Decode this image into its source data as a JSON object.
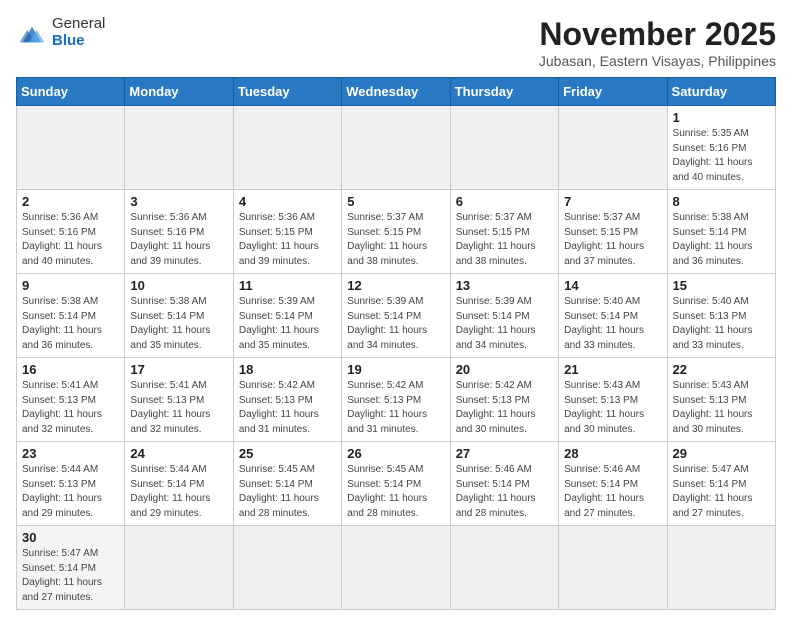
{
  "logo": {
    "line1": "General",
    "line2": "Blue"
  },
  "title": "November 2025",
  "subtitle": "Jubasan, Eastern Visayas, Philippines",
  "weekdays": [
    "Sunday",
    "Monday",
    "Tuesday",
    "Wednesday",
    "Thursday",
    "Friday",
    "Saturday"
  ],
  "weeks": [
    [
      {
        "day": "",
        "empty": true
      },
      {
        "day": "",
        "empty": true
      },
      {
        "day": "",
        "empty": true
      },
      {
        "day": "",
        "empty": true
      },
      {
        "day": "",
        "empty": true
      },
      {
        "day": "",
        "empty": true
      },
      {
        "day": "1",
        "sunrise": "5:35 AM",
        "sunset": "5:16 PM",
        "daylight": "11 hours and 40 minutes."
      }
    ],
    [
      {
        "day": "2",
        "sunrise": "5:36 AM",
        "sunset": "5:16 PM",
        "daylight": "11 hours and 40 minutes."
      },
      {
        "day": "3",
        "sunrise": "5:36 AM",
        "sunset": "5:16 PM",
        "daylight": "11 hours and 39 minutes."
      },
      {
        "day": "4",
        "sunrise": "5:36 AM",
        "sunset": "5:15 PM",
        "daylight": "11 hours and 39 minutes."
      },
      {
        "day": "5",
        "sunrise": "5:37 AM",
        "sunset": "5:15 PM",
        "daylight": "11 hours and 38 minutes."
      },
      {
        "day": "6",
        "sunrise": "5:37 AM",
        "sunset": "5:15 PM",
        "daylight": "11 hours and 38 minutes."
      },
      {
        "day": "7",
        "sunrise": "5:37 AM",
        "sunset": "5:15 PM",
        "daylight": "11 hours and 37 minutes."
      },
      {
        "day": "8",
        "sunrise": "5:38 AM",
        "sunset": "5:14 PM",
        "daylight": "11 hours and 36 minutes."
      }
    ],
    [
      {
        "day": "9",
        "sunrise": "5:38 AM",
        "sunset": "5:14 PM",
        "daylight": "11 hours and 36 minutes."
      },
      {
        "day": "10",
        "sunrise": "5:38 AM",
        "sunset": "5:14 PM",
        "daylight": "11 hours and 35 minutes."
      },
      {
        "day": "11",
        "sunrise": "5:39 AM",
        "sunset": "5:14 PM",
        "daylight": "11 hours and 35 minutes."
      },
      {
        "day": "12",
        "sunrise": "5:39 AM",
        "sunset": "5:14 PM",
        "daylight": "11 hours and 34 minutes."
      },
      {
        "day": "13",
        "sunrise": "5:39 AM",
        "sunset": "5:14 PM",
        "daylight": "11 hours and 34 minutes."
      },
      {
        "day": "14",
        "sunrise": "5:40 AM",
        "sunset": "5:14 PM",
        "daylight": "11 hours and 33 minutes."
      },
      {
        "day": "15",
        "sunrise": "5:40 AM",
        "sunset": "5:13 PM",
        "daylight": "11 hours and 33 minutes."
      }
    ],
    [
      {
        "day": "16",
        "sunrise": "5:41 AM",
        "sunset": "5:13 PM",
        "daylight": "11 hours and 32 minutes."
      },
      {
        "day": "17",
        "sunrise": "5:41 AM",
        "sunset": "5:13 PM",
        "daylight": "11 hours and 32 minutes."
      },
      {
        "day": "18",
        "sunrise": "5:42 AM",
        "sunset": "5:13 PM",
        "daylight": "11 hours and 31 minutes."
      },
      {
        "day": "19",
        "sunrise": "5:42 AM",
        "sunset": "5:13 PM",
        "daylight": "11 hours and 31 minutes."
      },
      {
        "day": "20",
        "sunrise": "5:42 AM",
        "sunset": "5:13 PM",
        "daylight": "11 hours and 30 minutes."
      },
      {
        "day": "21",
        "sunrise": "5:43 AM",
        "sunset": "5:13 PM",
        "daylight": "11 hours and 30 minutes."
      },
      {
        "day": "22",
        "sunrise": "5:43 AM",
        "sunset": "5:13 PM",
        "daylight": "11 hours and 30 minutes."
      }
    ],
    [
      {
        "day": "23",
        "sunrise": "5:44 AM",
        "sunset": "5:13 PM",
        "daylight": "11 hours and 29 minutes."
      },
      {
        "day": "24",
        "sunrise": "5:44 AM",
        "sunset": "5:14 PM",
        "daylight": "11 hours and 29 minutes."
      },
      {
        "day": "25",
        "sunrise": "5:45 AM",
        "sunset": "5:14 PM",
        "daylight": "11 hours and 28 minutes."
      },
      {
        "day": "26",
        "sunrise": "5:45 AM",
        "sunset": "5:14 PM",
        "daylight": "11 hours and 28 minutes."
      },
      {
        "day": "27",
        "sunrise": "5:46 AM",
        "sunset": "5:14 PM",
        "daylight": "11 hours and 28 minutes."
      },
      {
        "day": "28",
        "sunrise": "5:46 AM",
        "sunset": "5:14 PM",
        "daylight": "11 hours and 27 minutes."
      },
      {
        "day": "29",
        "sunrise": "5:47 AM",
        "sunset": "5:14 PM",
        "daylight": "11 hours and 27 minutes."
      }
    ],
    [
      {
        "day": "30",
        "sunrise": "5:47 AM",
        "sunset": "5:14 PM",
        "daylight": "11 hours and 27 minutes."
      },
      {
        "day": "",
        "empty": true
      },
      {
        "day": "",
        "empty": true
      },
      {
        "day": "",
        "empty": true
      },
      {
        "day": "",
        "empty": true
      },
      {
        "day": "",
        "empty": true
      },
      {
        "day": "",
        "empty": true
      }
    ]
  ],
  "labels": {
    "sunrise": "Sunrise:",
    "sunset": "Sunset:",
    "daylight": "Daylight:"
  }
}
